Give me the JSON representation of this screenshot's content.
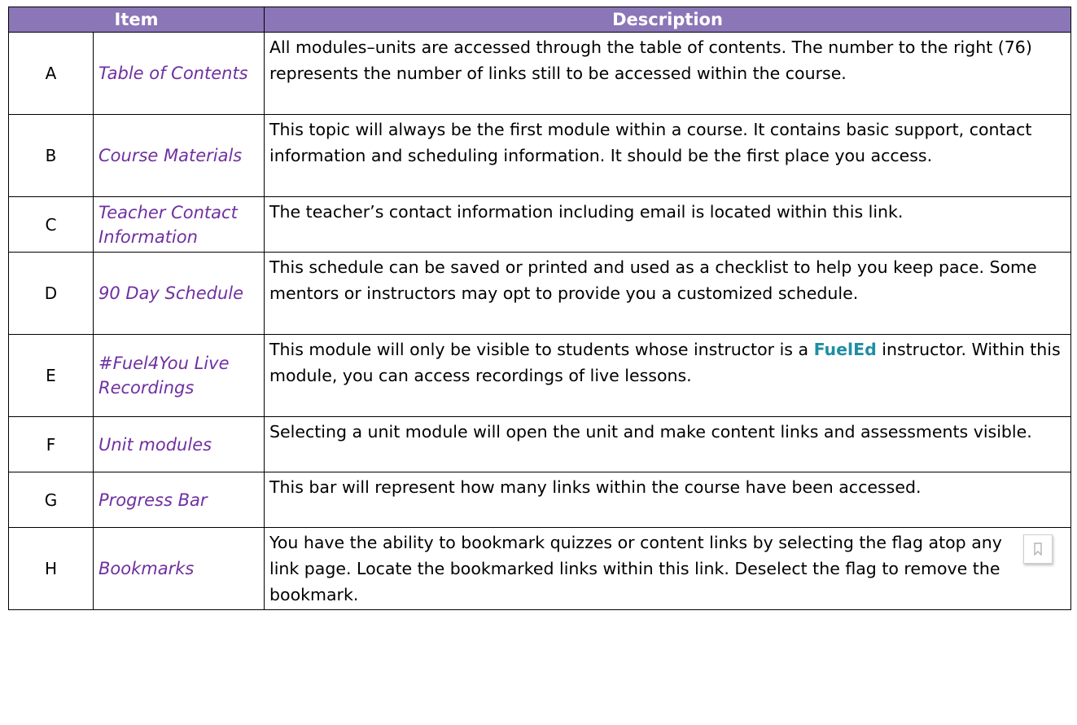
{
  "headers": {
    "item": "Item",
    "description": "Description"
  },
  "rows": [
    {
      "letter": "A",
      "item": "Table of Contents",
      "description": "All modules–units are accessed through the table of contents. The number to the right (76) represents the number of links still to be accessed within the course."
    },
    {
      "letter": "B",
      "item": "Course Materials",
      "description": "This topic will always be the first module within a course. It contains basic support, contact information and scheduling information. It should be the first place you access."
    },
    {
      "letter": "C",
      "item": "Teacher Contact Information",
      "description": "The teacher’s contact information including email is located within this link."
    },
    {
      "letter": "D",
      "item": "90 Day Schedule",
      "description": "This schedule can be saved or printed and used as a checklist to help you keep pace. Some mentors or instructors may opt to provide you a customized schedule."
    },
    {
      "letter": "E",
      "item": "#Fuel4You Live Recordings",
      "description_before": "This module will only be visible to students whose instructor is a ",
      "description_brand": "FuelEd",
      "description_after": " instructor. Within this module, you can access recordings of live lessons."
    },
    {
      "letter": "F",
      "item": "Unit modules",
      "description": "Selecting a unit module will open the unit and make content links and assessments visible."
    },
    {
      "letter": "G",
      "item": "Progress Bar",
      "description": "This bar will represent how many links within the course have been accessed."
    },
    {
      "letter": "H",
      "item": "Bookmarks",
      "description": "You have the ability to bookmark quizzes or content links by selecting the flag atop any link page. Locate the bookmarked links within this link. Deselect the flag to remove the bookmark."
    }
  ],
  "colors": {
    "header_bg": "#8b76b7",
    "item_text": "#7030a0",
    "brand_text": "#1f8ea3"
  },
  "icons": {
    "bookmark": "bookmark-flag-icon"
  }
}
